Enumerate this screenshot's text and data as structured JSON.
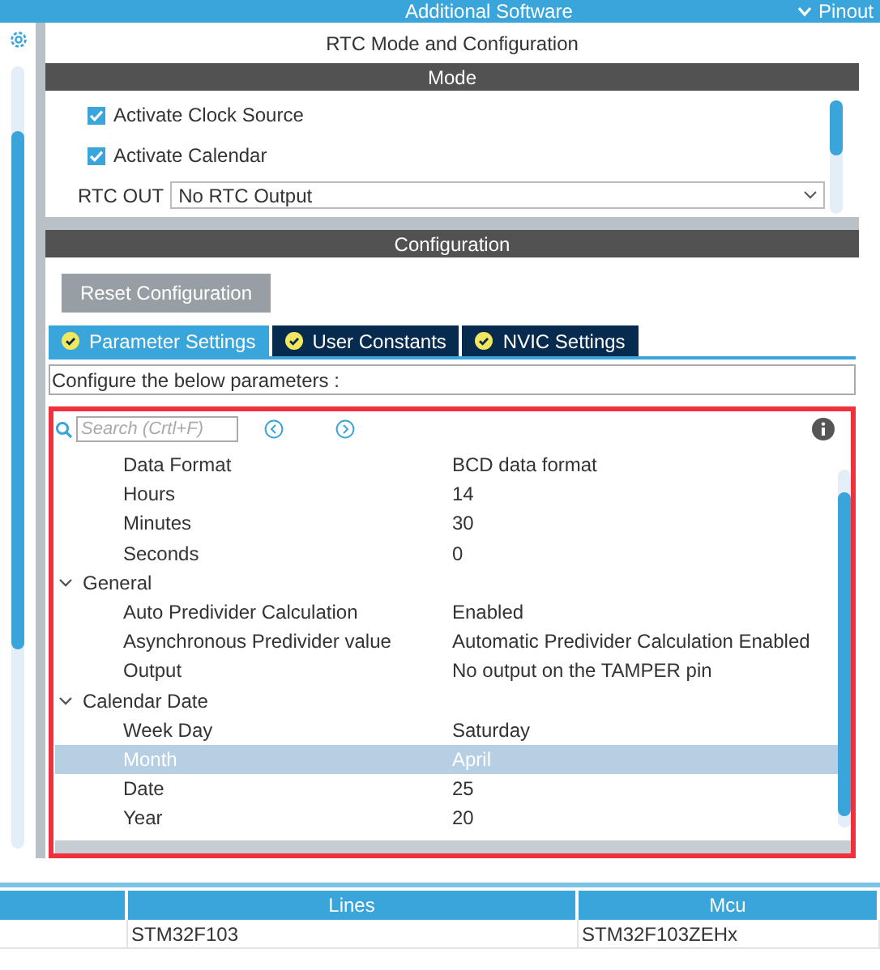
{
  "top_bar": {
    "title": "Additional Software",
    "pinout": "Pinout"
  },
  "panel": {
    "title": "RTC Mode and Configuration"
  },
  "mode": {
    "header": "Mode",
    "checkboxes": [
      {
        "label": "Activate Clock Source",
        "checked": true
      },
      {
        "label": "Activate Calendar",
        "checked": true
      }
    ],
    "rtc_out": {
      "label": "RTC OUT",
      "value": "No RTC Output"
    }
  },
  "configuration": {
    "header": "Configuration",
    "reset_button": "Reset Configuration",
    "tabs": [
      {
        "label": "Parameter Settings",
        "selected": true
      },
      {
        "label": "User Constants",
        "selected": false
      },
      {
        "label": "NVIC Settings",
        "selected": false
      }
    ],
    "hint": "Configure the below parameters :",
    "search": {
      "placeholder": "Search (Crtl+F)"
    },
    "tree": [
      {
        "kind": "param",
        "name": "Data Format",
        "value": "BCD data format",
        "selected": false
      },
      {
        "kind": "param",
        "name": "Hours",
        "value": "14",
        "selected": false
      },
      {
        "kind": "param",
        "name": "Minutes",
        "value": "30",
        "selected": false
      },
      {
        "kind": "param",
        "name": "Seconds",
        "value": "0",
        "selected": false
      },
      {
        "kind": "group",
        "name": "General",
        "expanded": true,
        "children": [
          {
            "kind": "param",
            "name": "Auto Predivider Calculation",
            "value": "Enabled",
            "selected": false
          },
          {
            "kind": "param",
            "name": "Asynchronous Predivider value",
            "value": "Automatic Predivider Calculation Enabled",
            "selected": false
          },
          {
            "kind": "param",
            "name": "Output",
            "value": "No output on the TAMPER pin",
            "selected": false
          }
        ]
      },
      {
        "kind": "group",
        "name": "Calendar Date",
        "expanded": true,
        "children": [
          {
            "kind": "param",
            "name": "Week Day",
            "value": "Saturday",
            "selected": false
          },
          {
            "kind": "param",
            "name": "Month",
            "value": "April",
            "selected": true
          },
          {
            "kind": "param",
            "name": "Date",
            "value": "25",
            "selected": false
          },
          {
            "kind": "param",
            "name": "Year",
            "value": "20",
            "selected": false
          }
        ]
      }
    ]
  },
  "table": {
    "columns": [
      "Lines",
      "Mcu"
    ],
    "rows": [
      {
        "lines": "STM32F103",
        "mcu": "STM32F103ZEHx"
      }
    ]
  }
}
